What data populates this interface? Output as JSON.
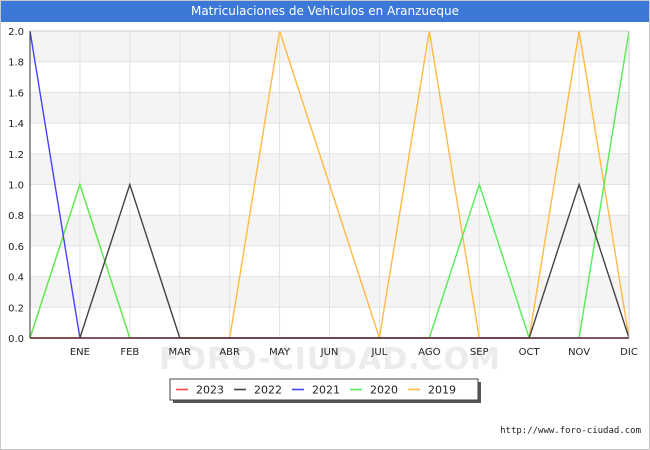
{
  "header": {
    "title": "Matriculaciones de Vehiculos en Aranzueque"
  },
  "footer": {
    "credit": "http://www.foro-ciudad.com"
  },
  "watermark": "FORO-CIUDAD.COM",
  "chart_data": {
    "type": "line",
    "title": "Matriculaciones de Vehiculos en Aranzueque",
    "xlabel": "",
    "ylabel": "",
    "x": [
      "",
      "ENE",
      "FEB",
      "MAR",
      "ABR",
      "MAY",
      "JUN",
      "JUL",
      "AGO",
      "SEP",
      "OCT",
      "NOV",
      "DIC"
    ],
    "ylim": [
      0,
      2
    ],
    "yticks": [
      "0.0",
      "0.2",
      "0.4",
      "0.6",
      "0.8",
      "1.0",
      "1.2",
      "1.4",
      "1.6",
      "1.8",
      "2.0"
    ],
    "grid": true,
    "legend_position": "bottom-center",
    "series": [
      {
        "name": "2023",
        "color": "#ff4444",
        "values": [
          0,
          0,
          0,
          0,
          0,
          0,
          0,
          0,
          0,
          0,
          0,
          0,
          0
        ]
      },
      {
        "name": "2022",
        "color": "#444444",
        "values": [
          0,
          0,
          1,
          0,
          0,
          0,
          0,
          0,
          0,
          0,
          0,
          1,
          0
        ]
      },
      {
        "name": "2021",
        "color": "#4444ff",
        "values": [
          2,
          0,
          0,
          0,
          0,
          0,
          0,
          0,
          0,
          0,
          0,
          0,
          0
        ]
      },
      {
        "name": "2020",
        "color": "#55ee55",
        "values": [
          0,
          1,
          0,
          0,
          0,
          0,
          0,
          0,
          0,
          1,
          0,
          0,
          2
        ]
      },
      {
        "name": "2019",
        "color": "#ffbb44",
        "values": [
          0,
          1,
          0,
          0,
          0,
          2,
          1,
          0,
          2,
          0,
          0,
          2,
          0
        ]
      }
    ]
  }
}
